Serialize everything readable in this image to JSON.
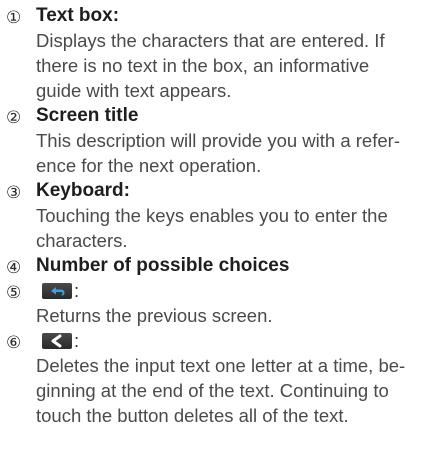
{
  "items": [
    {
      "num": "①",
      "title": "Text box:",
      "desc": [
        "Displays the characters that are entered. If",
        "there is no text in the box, an informative",
        "guide with text appears."
      ]
    },
    {
      "num": "②",
      "title": "Screen title",
      "desc": [
        "This description will provide you with a refer-",
        "ence for the next operation."
      ]
    },
    {
      "num": "③",
      "title": "Keyboard:",
      "desc": [
        "Touching the keys enables you to enter the",
        "characters."
      ]
    },
    {
      "num": "④",
      "title": "Number of possible choices",
      "desc": []
    },
    {
      "num": "⑤",
      "icon": "return-arrow-icon",
      "colon": ":",
      "desc": [
        "Returns the previous screen."
      ]
    },
    {
      "num": "⑥",
      "icon": "backspace-chevron-icon",
      "colon": ":",
      "desc": [
        "Deletes the input text one letter at a time, be-",
        "ginning at the end of the text. Continuing to",
        "touch the button deletes all of the text."
      ]
    }
  ],
  "colors": {
    "icon_bg": "#333333",
    "return_arrow": "#3aa0e8",
    "chevron": "#ffffff"
  }
}
